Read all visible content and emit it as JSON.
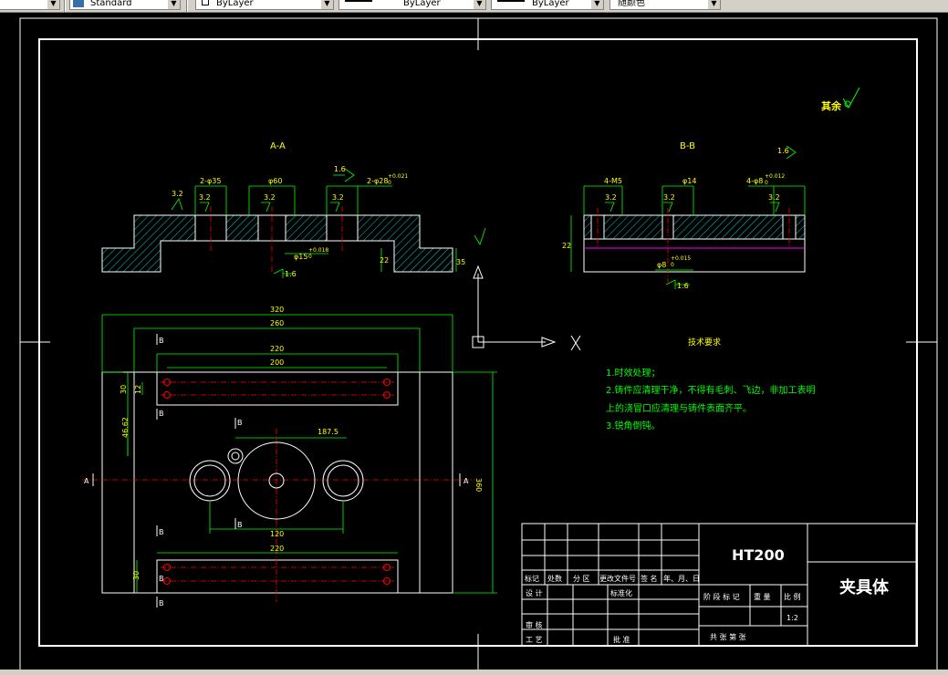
{
  "toolbar": {
    "left_arrow": "▼",
    "text_style": "Standard",
    "layer_1": "ByLayer",
    "layer_2": "ByLayer",
    "layer_3": "ByLayer",
    "color": "随颜色"
  },
  "drawing": {
    "section_a_title": "A-A",
    "section_b_title": "B-B",
    "rest_finish": "其余",
    "a": {
      "dim_2x35": "2-φ35",
      "dim_60": "φ60",
      "dim_2x28": "2-φ28",
      "tol_28": "+0.021",
      "tol_28b": "0",
      "roughness_left": "3.2",
      "roughness_mid": "3.2",
      "roughness_right": "3.2",
      "roughness_top": "1.6",
      "roughness_side": "3.2",
      "dim_15": "φ15",
      "tol_15": "+0.018",
      "tol_15b": "0",
      "bottom_roughness": "1.6",
      "dim_side_1": "22",
      "dim_side_2": "35"
    },
    "b": {
      "dim_4x15": "4-M5",
      "dim_14": "φ14",
      "dim_4x8": "4-φ8",
      "tol_8": "+0.012",
      "tol_8b": "0",
      "roughness_1": "3.2",
      "roughness_2": "3.2",
      "roughness_3": "3.2",
      "roughness_top": "1.6",
      "dim_height": "22",
      "dim_bottom": "φ8",
      "tol_bottom": "+0.015",
      "tol_bottom_b": "0",
      "bottom_roughness": "1.6"
    },
    "plan": {
      "dim_320": "320",
      "dim_260": "260",
      "dim_220_top": "220",
      "dim_200": "200",
      "dim_30_top": "30",
      "dim_12": "12",
      "dim_40": "46.62",
      "dim_187": "187.5",
      "dim_120": "120",
      "dim_220_bottom": "220",
      "dim_30_bottom": "30",
      "dim_height_right": "360",
      "label_b_1": "B",
      "label_b_2": "B",
      "label_b_3": "B",
      "label_b_4": "B",
      "label_b_5": "B",
      "label_b_6": "B",
      "label_b_7": "B",
      "label_a_left": "A",
      "label_a_right": "A"
    },
    "tech": {
      "title": "技术要求",
      "line1": "1.时效处理；",
      "line2": "2.铸件应清理干净，不得有毛刺、飞边，非加工表明",
      "line3": "上的浇冒口应清理与铸件表面齐平。",
      "line4": "3.锐角倒钝。"
    },
    "titleblock": {
      "material": "HT200",
      "part_name": "夹具体",
      "c_mark": "标记",
      "c_count": "处数",
      "c_zone": "分 区",
      "c_docno": "更改文件号",
      "c_sign": "签 名",
      "c_date": "年、月、日",
      "design": "设 计",
      "standard": "标准化",
      "review": "审 核",
      "process": "工 艺",
      "approve": "批 准",
      "stage": "阶 段 标 记",
      "weight": "重 量",
      "scale_label": "比 例",
      "scale": "1:2",
      "sheets": "共    张  第    张"
    }
  }
}
